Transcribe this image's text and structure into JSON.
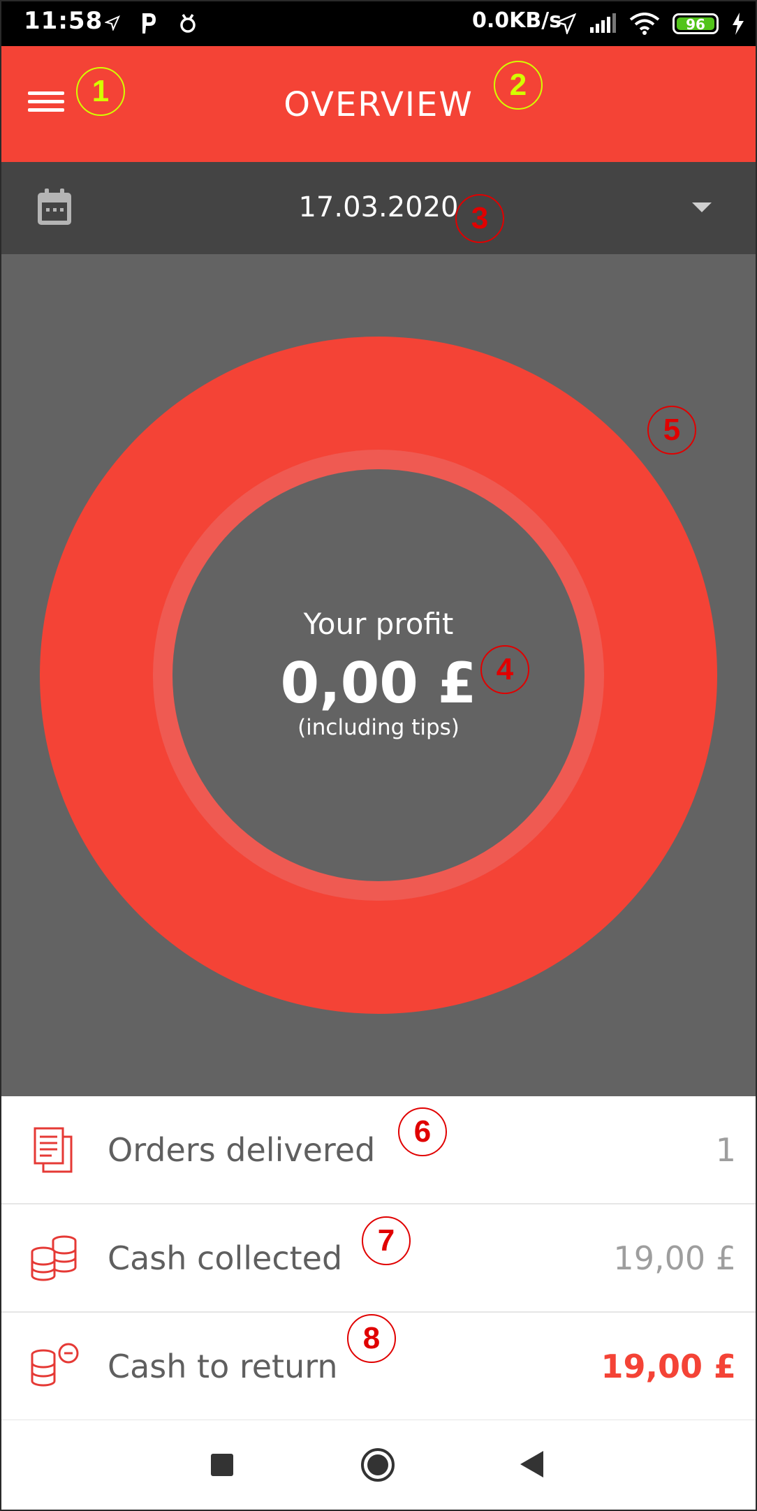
{
  "status_bar": {
    "time": "11:58",
    "network_speed": "0.0KB/s",
    "battery_level": "96",
    "icons_left": [
      "navigation-icon",
      "parking-app-icon",
      "bug-icon"
    ],
    "icons_right": [
      "location-icon",
      "signal-icon",
      "wifi-icon",
      "battery-icon",
      "charging-icon"
    ]
  },
  "appbar": {
    "title": "OVERVIEW",
    "menu_icon": "hamburger-menu-icon"
  },
  "date_selector": {
    "date": "17.03.2020",
    "icon": "calendar-icon"
  },
  "profit": {
    "label": "Your profit",
    "value": "0,00 £",
    "sub": "(including tips)"
  },
  "stats": [
    {
      "label": "Orders delivered",
      "value": "1",
      "icon": "documents-icon"
    },
    {
      "label": "Cash collected",
      "value": "19,00 £",
      "icon": "coins-icon"
    },
    {
      "label": "Cash to return",
      "value": "19,00 £",
      "icon": "coins-minus-icon"
    }
  ],
  "callouts": [
    "1",
    "2",
    "3",
    "4",
    "5",
    "6",
    "7",
    "8"
  ],
  "colors": {
    "primary": "#f44336",
    "date_bar": "#444444",
    "background_gray": "#636363",
    "callout_yellow": "#d4ff00",
    "callout_red": "#e00000"
  }
}
